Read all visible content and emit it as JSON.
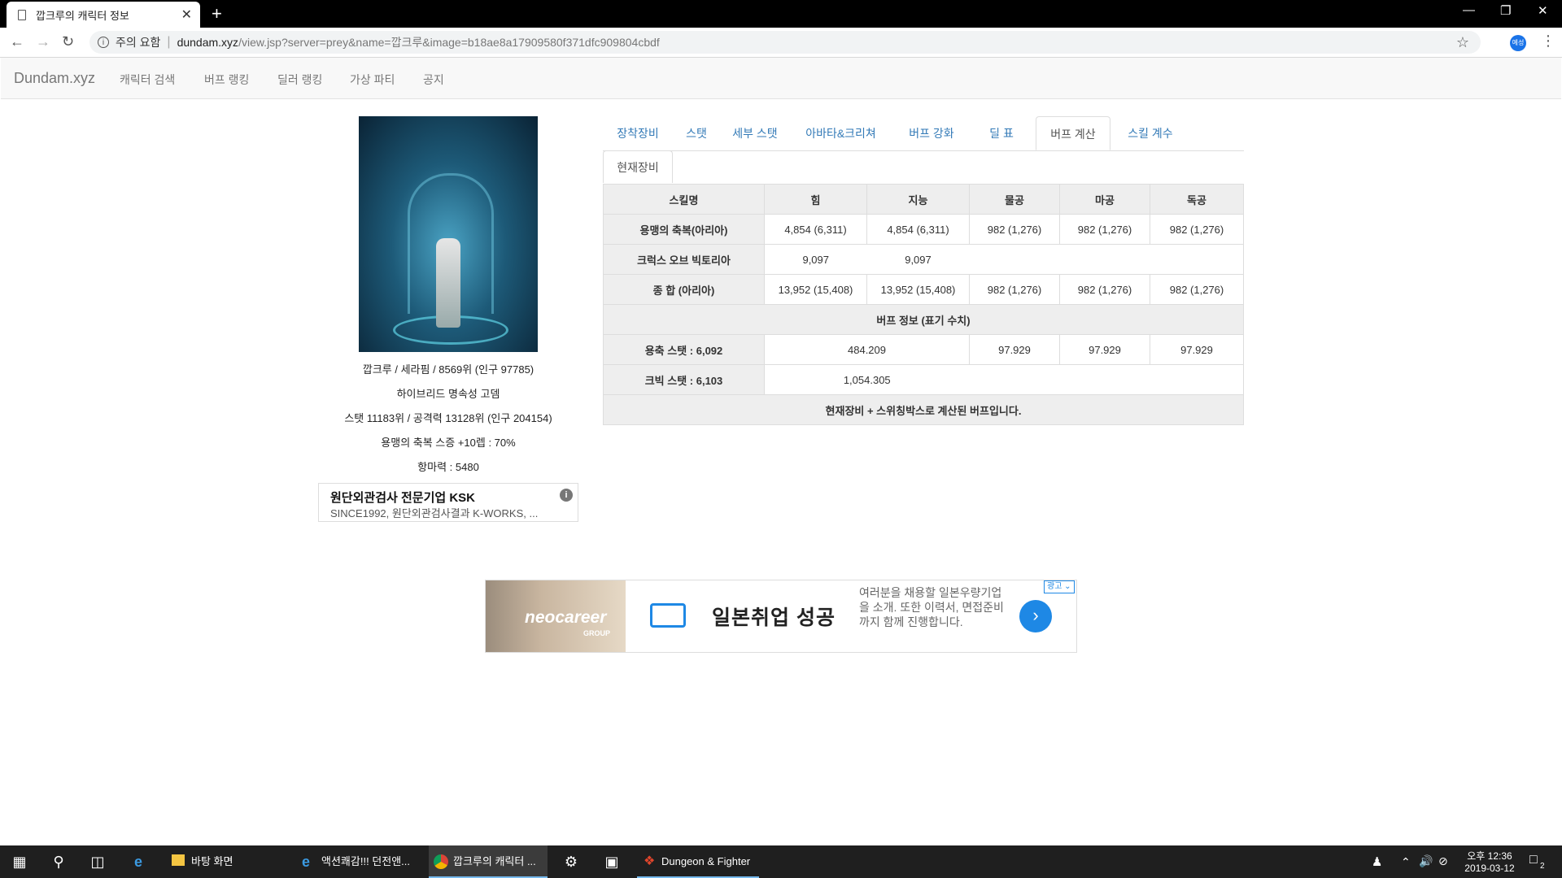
{
  "browser": {
    "tab_title": "깝크루의 캐릭터 정보",
    "tab_close": "✕",
    "new_tab": "+",
    "security_label": "주의 요함",
    "url_domain": "dundam.xyz",
    "url_path": "/view.jsp?server=prey&name=깝크루&image=b18ae8a17909580f371dfc909804cbdf",
    "profile_initial": "예성"
  },
  "site": {
    "brand": "Dundam.xyz",
    "menu": [
      "캐릭터 검색",
      "버프 랭킹",
      "딜러 랭킹",
      "가상 파티",
      "공지"
    ]
  },
  "character": {
    "line1": "깝크루 / 세라핌 / 8569위 (인구 97785)",
    "line2": "하이브리드 명속성 고뎀",
    "line3": "스탯 11183위 / 공격력 13128위 (인구 204154)",
    "line4": "용맹의 축복 스증 +10렙 : 70%",
    "line5": "항마력 : 5480"
  },
  "side_ad": {
    "headline": "원단외관검사 전문기업 KSK",
    "text": "SINCE1992, 원단외관검사결과 K-WORKS, ...",
    "info": "i"
  },
  "tabs": [
    "장착장비",
    "스탯",
    "세부 스탯",
    "아바타&크리쳐",
    "버프 강화",
    "딜 표",
    "버프 계산",
    "스킬 계수"
  ],
  "active_tab": "버프 계산",
  "subtab": "현재장비",
  "table": {
    "headers": [
      "스킬명",
      "힘",
      "지능",
      "물공",
      "마공",
      "독공"
    ],
    "rows": [
      {
        "name": "용맹의 축복(아리아)",
        "str": "4,854 (6,311)",
        "int": "4,854 (6,311)",
        "phys": "982 (1,276)",
        "mag": "982 (1,276)",
        "ind": "982 (1,276)"
      },
      {
        "name": "크럭스 오브 빅토리아",
        "str": "9,097",
        "int": "9,097",
        "phys": "",
        "mag": "",
        "ind": ""
      },
      {
        "name": "종 합 (아리아)",
        "str": "13,952 (15,408)",
        "int": "13,952 (15,408)",
        "phys": "982 (1,276)",
        "mag": "982 (1,276)",
        "ind": "982 (1,276)"
      }
    ],
    "section_title": "버프 정보 (표기 수치)",
    "buff_rows": [
      {
        "name_label": "용축 스탯 : ",
        "name_value": "6,092",
        "stat": "484.209",
        "phys": "97.929",
        "mag": "97.929",
        "ind": "97.929"
      },
      {
        "name_label": "크빅 스탯 : ",
        "name_value": "6,103",
        "stat": "1,054.305",
        "phys": "",
        "mag": "",
        "ind": ""
      }
    ],
    "footer": "현재장비 + 스위칭박스로 계산된 버프입니다."
  },
  "bottom_ad": {
    "logo": "neocareer",
    "logo_sub": "GROUP",
    "headline": "일본취업 성공",
    "body": "여러분을 채용할 일본우량기업을 소개. 또한 이력서, 면접준비까지 함께 진행합니다.",
    "badge": "광고 ⌄",
    "arrow": "›"
  },
  "taskbar": {
    "items": [
      "바탕 화면",
      "액션쾌감!!! 던전앤...",
      "깝크루의 캐릭터 ...",
      "Dungeon & Fighter"
    ],
    "time": "오후 12:36",
    "date": "2019-03-12",
    "notif_count": "2"
  },
  "icons": {
    "back": "back-arrow-icon",
    "forward": "forward-arrow-icon",
    "reload": "reload-icon",
    "star": "bookmark-star-icon",
    "menu": "kebab-menu-icon",
    "start": "windows-start-icon",
    "search": "search-icon",
    "taskview": "task-view-icon"
  }
}
